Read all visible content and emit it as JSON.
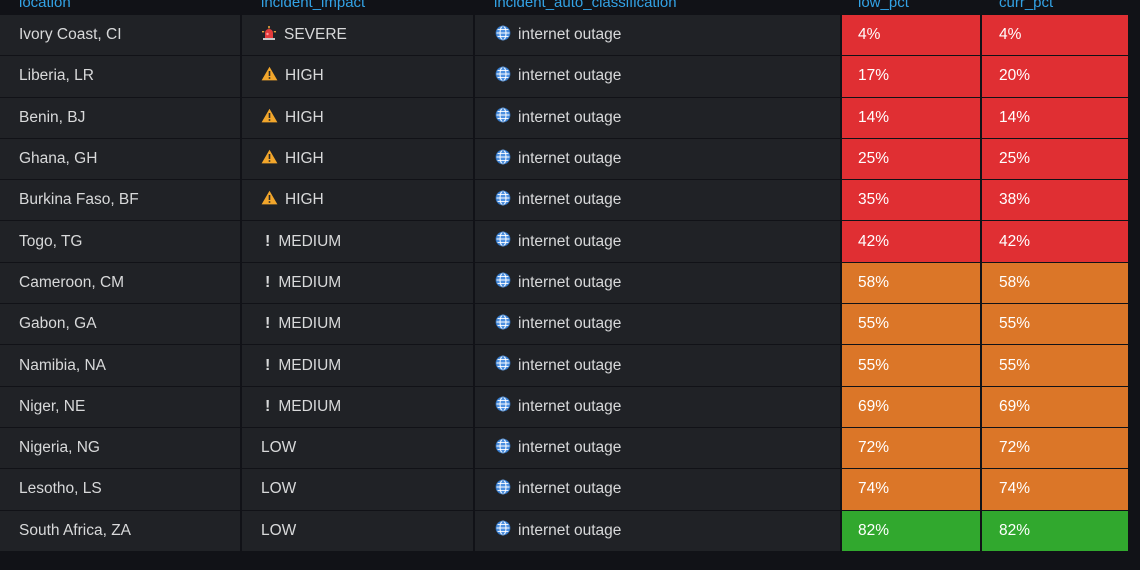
{
  "columns": [
    "location",
    "incident_impact",
    "incident_auto_classification",
    "low_pct",
    "curr_pct"
  ],
  "colors": {
    "header_text": "#33a2e5",
    "red": "#e02f33",
    "orange": "#db7628",
    "green": "#31a82e",
    "cell_bg": "#202226"
  },
  "rows": [
    {
      "location": "Ivory Coast, CI",
      "impact": "SEVERE",
      "impact_icon": "siren-icon",
      "classification": "internet outage",
      "low_pct": "4%",
      "curr_pct": "4%",
      "low_level": "red",
      "curr_level": "red"
    },
    {
      "location": "Liberia, LR",
      "impact": "HIGH",
      "impact_icon": "warning-icon",
      "classification": "internet outage",
      "low_pct": "17%",
      "curr_pct": "20%",
      "low_level": "red",
      "curr_level": "red"
    },
    {
      "location": "Benin, BJ",
      "impact": "HIGH",
      "impact_icon": "warning-icon",
      "classification": "internet outage",
      "low_pct": "14%",
      "curr_pct": "14%",
      "low_level": "red",
      "curr_level": "red"
    },
    {
      "location": "Ghana, GH",
      "impact": "HIGH",
      "impact_icon": "warning-icon",
      "classification": "internet outage",
      "low_pct": "25%",
      "curr_pct": "25%",
      "low_level": "red",
      "curr_level": "red"
    },
    {
      "location": "Burkina Faso, BF",
      "impact": "HIGH",
      "impact_icon": "warning-icon",
      "classification": "internet outage",
      "low_pct": "35%",
      "curr_pct": "38%",
      "low_level": "red",
      "curr_level": "red"
    },
    {
      "location": "Togo, TG",
      "impact": "MEDIUM",
      "impact_icon": "exclamation-icon",
      "classification": "internet outage",
      "low_pct": "42%",
      "curr_pct": "42%",
      "low_level": "red",
      "curr_level": "red"
    },
    {
      "location": "Cameroon, CM",
      "impact": "MEDIUM",
      "impact_icon": "exclamation-icon",
      "classification": "internet outage",
      "low_pct": "58%",
      "curr_pct": "58%",
      "low_level": "orange",
      "curr_level": "orange"
    },
    {
      "location": "Gabon, GA",
      "impact": "MEDIUM",
      "impact_icon": "exclamation-icon",
      "classification": "internet outage",
      "low_pct": "55%",
      "curr_pct": "55%",
      "low_level": "orange",
      "curr_level": "orange"
    },
    {
      "location": "Namibia, NA",
      "impact": "MEDIUM",
      "impact_icon": "exclamation-icon",
      "classification": "internet outage",
      "low_pct": "55%",
      "curr_pct": "55%",
      "low_level": "orange",
      "curr_level": "orange"
    },
    {
      "location": "Niger, NE",
      "impact": "MEDIUM",
      "impact_icon": "exclamation-icon",
      "classification": "internet outage",
      "low_pct": "69%",
      "curr_pct": "69%",
      "low_level": "orange",
      "curr_level": "orange"
    },
    {
      "location": "Nigeria, NG",
      "impact": "LOW",
      "impact_icon": "",
      "classification": "internet outage",
      "low_pct": "72%",
      "curr_pct": "72%",
      "low_level": "orange",
      "curr_level": "orange"
    },
    {
      "location": "Lesotho, LS",
      "impact": "LOW",
      "impact_icon": "",
      "classification": "internet outage",
      "low_pct": "74%",
      "curr_pct": "74%",
      "low_level": "orange",
      "curr_level": "orange"
    },
    {
      "location": "South Africa, ZA",
      "impact": "LOW",
      "impact_icon": "",
      "classification": "internet outage",
      "low_pct": "82%",
      "curr_pct": "82%",
      "low_level": "green",
      "curr_level": "green"
    }
  ]
}
